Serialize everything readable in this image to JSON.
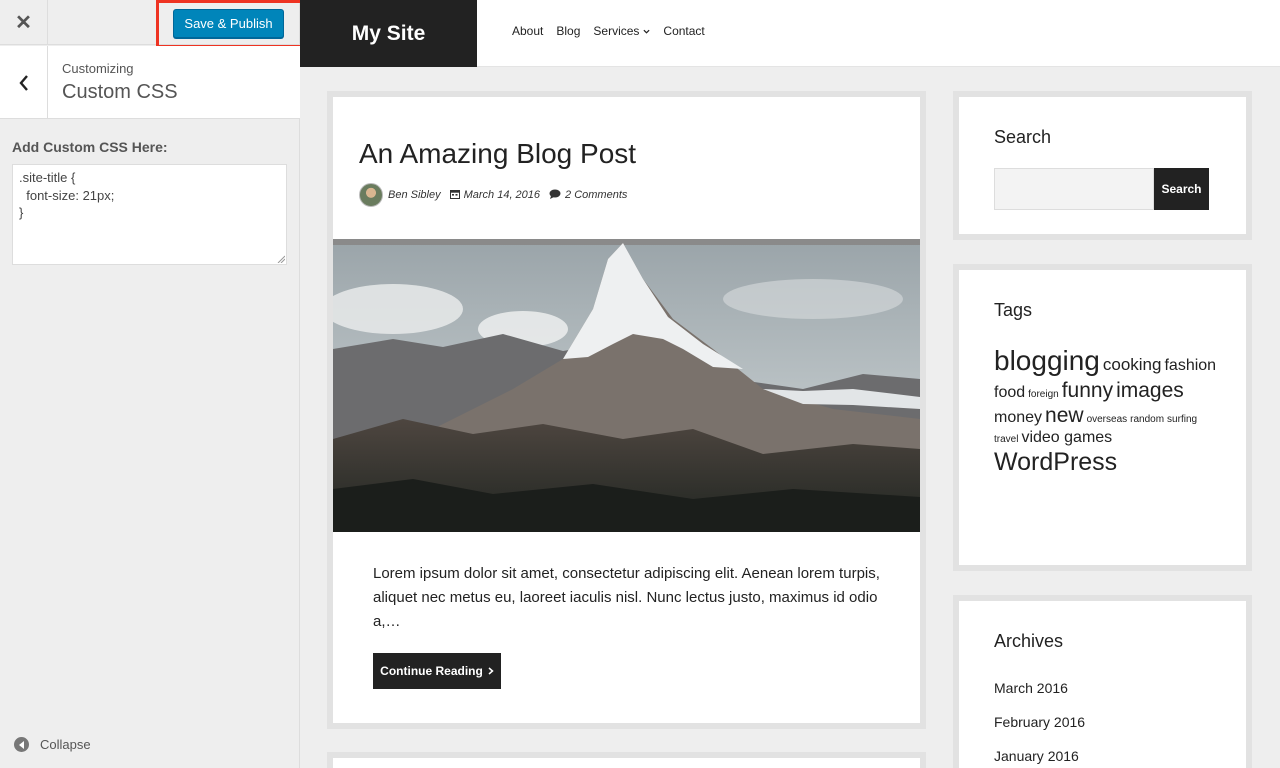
{
  "customizer": {
    "publish_label": "Save & Publish",
    "customizing_label": "Customizing",
    "section_title": "Custom CSS",
    "css_field_label": "Add Custom CSS Here:",
    "css_value": ".site-title {\n  font-size: 21px;\n}",
    "collapse_label": "Collapse",
    "close_glyph": "✕",
    "accent_color": "#0085ba",
    "highlight_color": "#ee3322"
  },
  "site": {
    "title": "My Site",
    "nav": [
      "About",
      "Blog",
      "Services",
      "Contact"
    ]
  },
  "post": {
    "title": "An Amazing Blog Post",
    "author": "Ben Sibley",
    "date": "March 14, 2016",
    "comments": "2 Comments",
    "excerpt": "Lorem ipsum dolor sit amet, consectetur adipiscing elit. Aenean lorem turpis, aliquet nec metus eu, laoreet iaculis nisl. Nunc lectus justo, maximus id odio a,…",
    "continue_label": "Continue Reading"
  },
  "widgets": {
    "search": {
      "title": "Search",
      "button_label": "Search"
    },
    "tags": {
      "title": "Tags",
      "items": [
        {
          "label": "blogging",
          "size": 28
        },
        {
          "label": "cooking",
          "size": 17
        },
        {
          "label": "fashion",
          "size": 16
        },
        {
          "label": "food",
          "size": 16
        },
        {
          "label": "foreign",
          "size": 10
        },
        {
          "label": "funny",
          "size": 21
        },
        {
          "label": "images",
          "size": 21
        },
        {
          "label": "money",
          "size": 16
        },
        {
          "label": "new",
          "size": 21
        },
        {
          "label": "overseas",
          "size": 10
        },
        {
          "label": "random",
          "size": 10
        },
        {
          "label": "surfing",
          "size": 10
        },
        {
          "label": "travel",
          "size": 10
        },
        {
          "label": "video games",
          "size": 16
        },
        {
          "label": "WordPress",
          "size": 25
        }
      ]
    },
    "archives": {
      "title": "Archives",
      "items": [
        "March 2016",
        "February 2016",
        "January 2016"
      ]
    }
  }
}
